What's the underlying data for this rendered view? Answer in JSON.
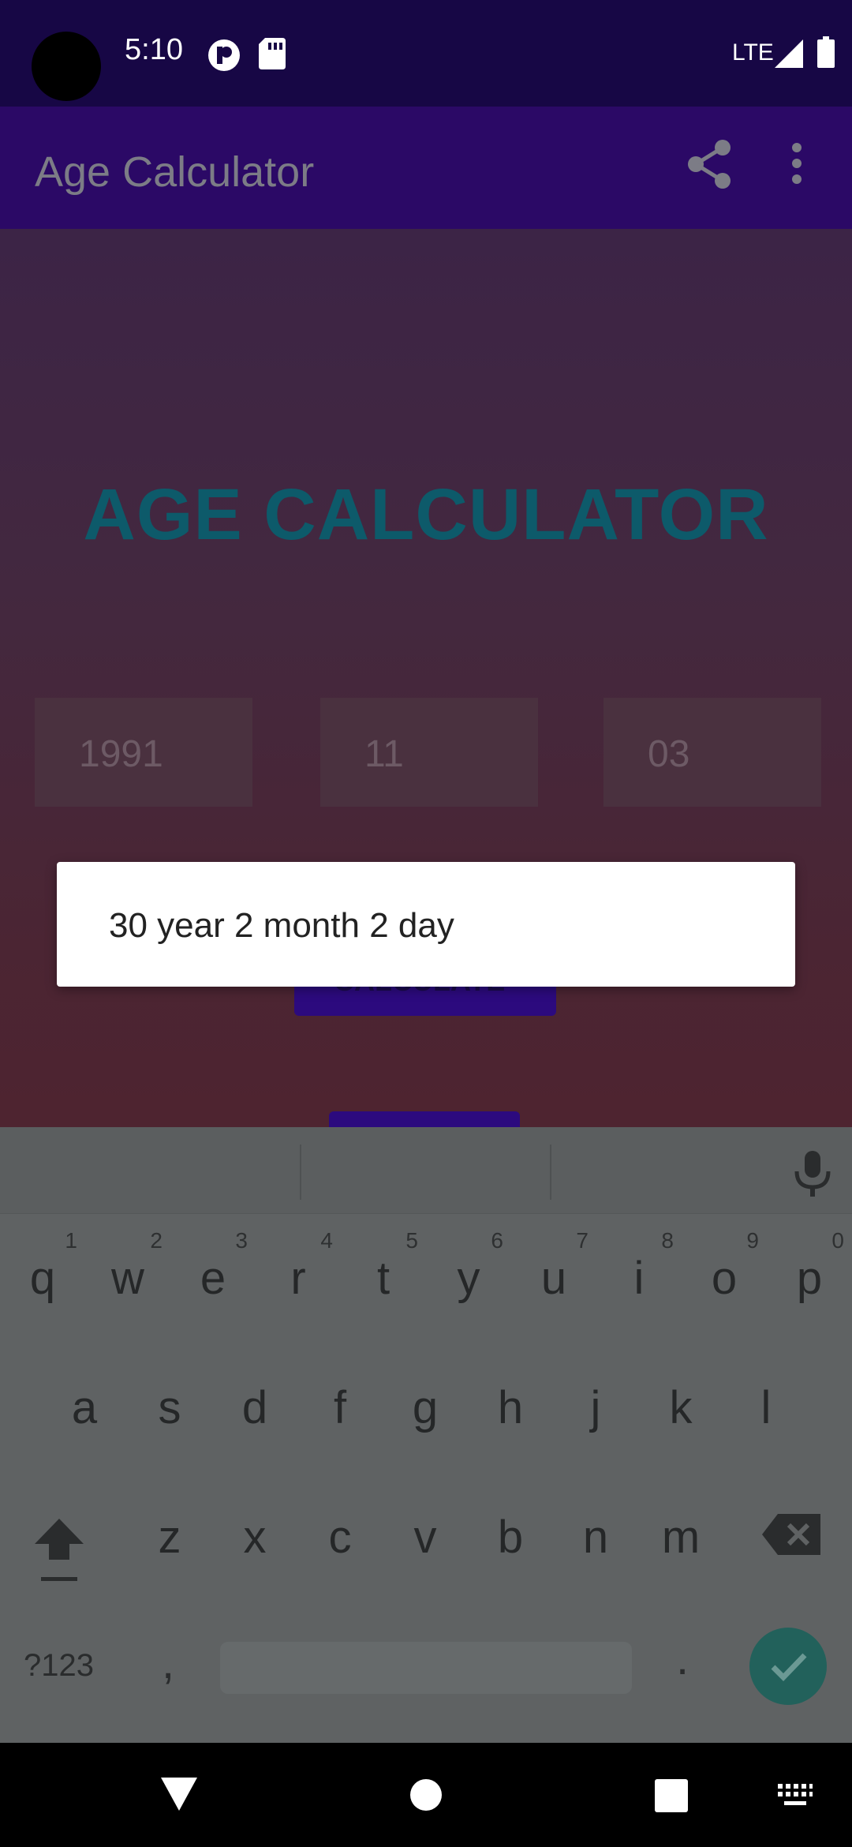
{
  "status_bar": {
    "time": "5:10",
    "network": "LTE",
    "icons": [
      "camera-cutout",
      "app-notification-icon",
      "sd-card-icon",
      "signal-icon",
      "battery-icon"
    ]
  },
  "app_bar": {
    "title": "Age Calculator",
    "actions": [
      "share-icon",
      "more-options-icon"
    ]
  },
  "main": {
    "headline": "AGE CALCULATOR",
    "year_value": "1991",
    "month_value": "11",
    "day_value": "03",
    "calculate_label": "CALCULATE"
  },
  "dialog": {
    "message": "30 year 2 month 2 day"
  },
  "keyboard": {
    "row1": [
      {
        "key": "q",
        "hint": "1"
      },
      {
        "key": "w",
        "hint": "2"
      },
      {
        "key": "e",
        "hint": "3"
      },
      {
        "key": "r",
        "hint": "4"
      },
      {
        "key": "t",
        "hint": "5"
      },
      {
        "key": "y",
        "hint": "6"
      },
      {
        "key": "u",
        "hint": "7"
      },
      {
        "key": "i",
        "hint": "8"
      },
      {
        "key": "o",
        "hint": "9"
      },
      {
        "key": "p",
        "hint": "0"
      }
    ],
    "row2": [
      "a",
      "s",
      "d",
      "f",
      "g",
      "h",
      "j",
      "k",
      "l"
    ],
    "row3": [
      "z",
      "x",
      "c",
      "v",
      "b",
      "n",
      "m"
    ],
    "symbols_label": "?123",
    "comma": ",",
    "period": "."
  },
  "colors": {
    "status_bar": "#170745",
    "app_bar": "#2b0966",
    "headline": "#0d5a6a",
    "button": "#2c0a7e",
    "enter_key": "#22615b"
  }
}
